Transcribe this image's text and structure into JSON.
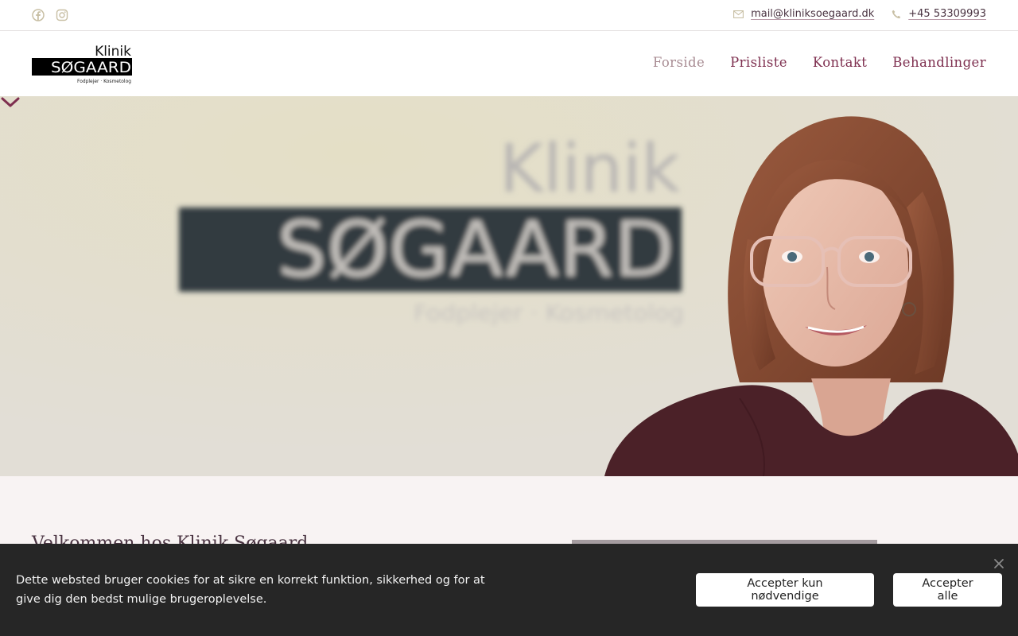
{
  "topbar": {
    "social_icons": [
      "facebook-icon",
      "instagram-icon"
    ],
    "email": "mail@kliniksoegaard.dk",
    "phone": "+45 53309993",
    "icon_color": "#c8bfa4"
  },
  "logo": {
    "line1": "Klinik",
    "line2": "SØGAARD",
    "line3": "Fodplejer · Kosmetolog"
  },
  "nav": {
    "items": [
      "Forside",
      "Prisliste",
      "Kontakt",
      "Behandlinger"
    ],
    "active": "Forside",
    "color": "#7e2f4f",
    "active_color": "#a88c93"
  },
  "hero": {
    "sign_line1": "Klinik",
    "sign_line2": "SØGAARD",
    "sign_line3": "Fodplejer · Kosmetolog",
    "scroll_icon": "chevron-down-icon"
  },
  "section": {
    "welcome_title": "Velkommen hos Klinik Søgaard"
  },
  "cookie": {
    "text": "Dette websted bruger cookies for at sikre en korrekt funktion, sikkerhed og for at give dig den bedst mulige brugeroplevelse.",
    "btn_necessary": "Accepter kun nødvendige",
    "btn_all": "Accepter alle",
    "close_icon": "close-icon"
  }
}
